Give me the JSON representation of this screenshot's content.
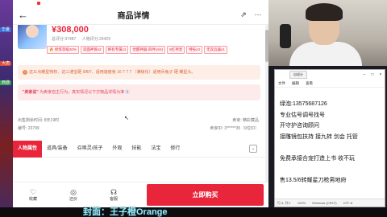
{
  "side_tags": [
    {
      "label": "华夏",
      "color": "#3a6fd8"
    },
    {
      "label": "大唐",
      "color": "#d84a3a"
    },
    {
      "label": "西游",
      "color": "#38a05a"
    }
  ],
  "app": {
    "title": "商品详情",
    "price": "¥308,000",
    "stats": {
      "collect": "总评分:37487",
      "views": "人物评分:24429"
    },
    "tags": [
      "🔥 修炼等级20%",
      "双面神兽x2",
      "稀有专属x1",
      "觉醒神器·四件(4/4)",
      "8红神宠",
      "特技x3",
      "无双兵器x1"
    ],
    "notice1": {
      "icon": "!",
      "text": "这11点耀星特权、这三通宝砸 9/8/7、适用速度免 16 7 7 7 （满级化）适用兵兔子 砸 耀星头。"
    },
    "notice2": {
      "prefix": "\"卖家说\"",
      "text": " 为卖家自主行为，真实情况以下方物品详情为准 ",
      "link": "⓪"
    },
    "info": {
      "left": [
        "出售剩余时间: 8天19时",
        "编号: 23799"
      ],
      "right": [
        "卖家: 精彩藏品",
        "卖家ID: 3******35（9位ID）"
      ]
    },
    "tabs": [
      "人物属性",
      "道具/装备",
      "召唤灵/孩子",
      "外观",
      "技能",
      "法宝",
      "修行"
    ],
    "bottom": {
      "collect": "收藏",
      "bargain": "还价",
      "service": "客服",
      "buy": "立即购买"
    }
  },
  "notepad": {
    "tab_label": "自说计",
    "menu": [
      "文件",
      "编辑",
      "查看"
    ],
    "lines": [
      "绿泡:13575687126",
      "专业估号调号找号",
      "开守护咨询顾问",
      "接雕镜包扶持 接九转 剑会 托管",
      "",
      "免费承接合宠打造上书 收不玩",
      "",
      "售13.5/6转耀星刀枪男地府"
    ],
    "status": [
      "行 8, 列 1",
      "100%",
      "Windows (CRLF)",
      "UTF-8"
    ]
  },
  "caption": "封面：王子橙Orange"
}
